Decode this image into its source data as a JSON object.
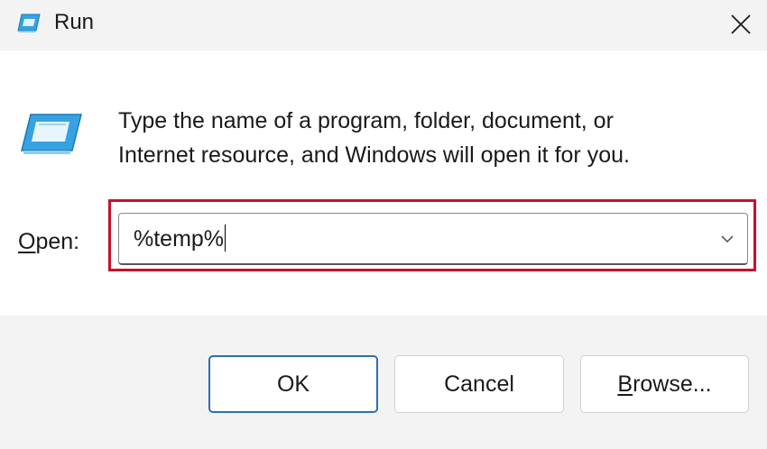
{
  "window": {
    "title": "Run",
    "icon": "run-dialog-icon",
    "close_icon": "close-icon",
    "accent": "#2a6fb5",
    "highlight_color": "#c8102e"
  },
  "content": {
    "description_lines": [
      "Type the name of a program, folder, document, or",
      "Internet resource, and Windows will open it for you."
    ],
    "open_label_mnemonic": "O",
    "open_label_rest": "pen:",
    "input_value": "%temp%",
    "dropdown_icon": "chevron-down-icon"
  },
  "buttons": {
    "ok": "OK",
    "cancel": "Cancel",
    "browse_mnemonic": "B",
    "browse_rest": "rowse..."
  }
}
